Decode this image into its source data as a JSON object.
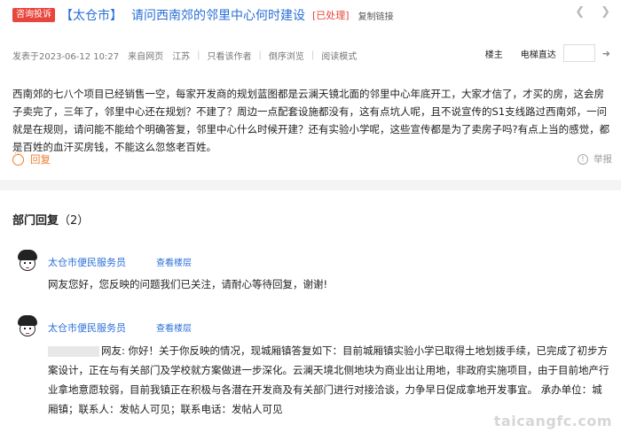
{
  "header": {
    "tag": "咨询投诉",
    "forum": "【太仓市】",
    "title": "请问西南郊的邻里中心何时建设",
    "status": "[已处理]",
    "copy_link": "复制链接",
    "prev_icon": "left-arrow-icon",
    "next_icon": "right-arrow-icon"
  },
  "meta": {
    "posted": "发表于2023-06-12 10:27",
    "source": "来自网页",
    "location": "江苏",
    "author_only": "只看该作者",
    "reverse": "倒序浏览",
    "read_mode": "阅读模式",
    "owner": "楼主",
    "jump_label": "电梯直达",
    "jump_value": ""
  },
  "post": {
    "body": "西南郊的七八个项目已经销售一空，每家开发商的规划蓝图都是云澜天镜北面的邻里中心年底开工，大家才信了，才买的房，这会房子卖完了，三年了，邻里中心还在规划？不建了？周边一点配套设施都没有，这有点坑人呢，且不说宣传的S1支线路过西南郊，一问就是在规则，请问能不能给个明确答复，邻里中心什么时候开建？还有实验小学呢，这些宣传都是为了卖房子吗?有点上当的感觉，都是百姓的血汗买房钱，不能这么忽悠老百姓。",
    "reply": "回复",
    "report": "举报"
  },
  "dept": {
    "heading": "部门回复",
    "count": "（2）",
    "replies": [
      {
        "name": "太仓市便民服务员",
        "view": "查看楼层",
        "text": "网友您好，您反映的问题我们已关注，请耐心等待回复，谢谢!"
      },
      {
        "name": "太仓市便民服务员",
        "view": "查看楼层",
        "text": "网友:  你好！关于你反映的情况，现城厢镇答复如下：目前城厢镇实验小学已取得土地划拨手续，已完成了初步方案设计，正在与有关部门及学校就方案做进一步深化。云澜天境北侧地块为商业出让用地，非政府实施项目，由于目前地产行业拿地意愿较弱，目前我镇正在积极与各潜在开发商及有关部门进行对接洽谈，力争早日促成拿地开发事宜。  承办单位：城厢镇；联系人：发帖人可见；联系电话：发帖人可见"
      }
    ]
  },
  "watermark": "taicangfc.com",
  "colors": {
    "link": "#2a6fd6",
    "status": "#e8453c",
    "reply": "#ef7d2c"
  }
}
